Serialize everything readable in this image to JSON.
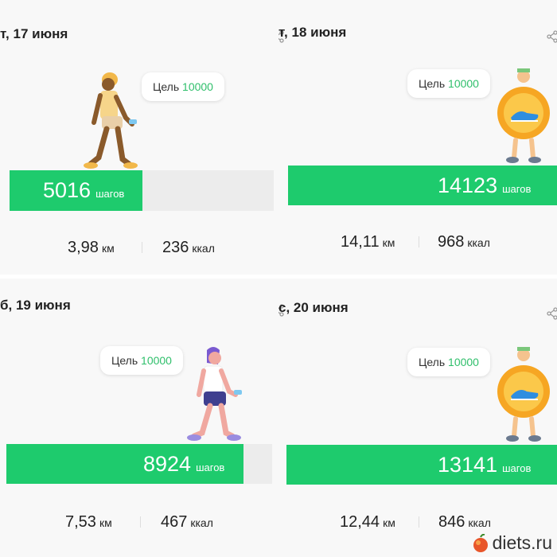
{
  "cards": [
    {
      "date": "т, 17 июня",
      "goal_label": "Цель",
      "goal_value": "10000",
      "steps": "5016",
      "steps_unit": "шагов",
      "progress": 0.5016,
      "distance": "3,98",
      "distance_unit": "км",
      "calories": "236",
      "calories_unit": "ккал"
    },
    {
      "date": "т, 18 июня",
      "goal_label": "Цель",
      "goal_value": "10000",
      "steps": "14123",
      "steps_unit": "шагов",
      "progress": 1.0,
      "distance": "14,11",
      "distance_unit": "км",
      "calories": "968",
      "calories_unit": "ккал"
    },
    {
      "date": "б, 19 июня",
      "goal_label": "Цель",
      "goal_value": "10000",
      "steps": "8924",
      "steps_unit": "шагов",
      "progress": 0.8924,
      "distance": "7,53",
      "distance_unit": "км",
      "calories": "467",
      "calories_unit": "ккал"
    },
    {
      "date": "с, 20 июня",
      "goal_label": "Цель",
      "goal_value": "10000",
      "steps": "13141",
      "steps_unit": "шагов",
      "progress": 1.0,
      "distance": "12,44",
      "distance_unit": "км",
      "calories": "846",
      "calories_unit": "ккал"
    }
  ],
  "watermark": "diets.ru",
  "colors": {
    "accent": "#1ecb6d",
    "goal_text": "#2fbf6b",
    "bar_bg": "#ececec"
  }
}
